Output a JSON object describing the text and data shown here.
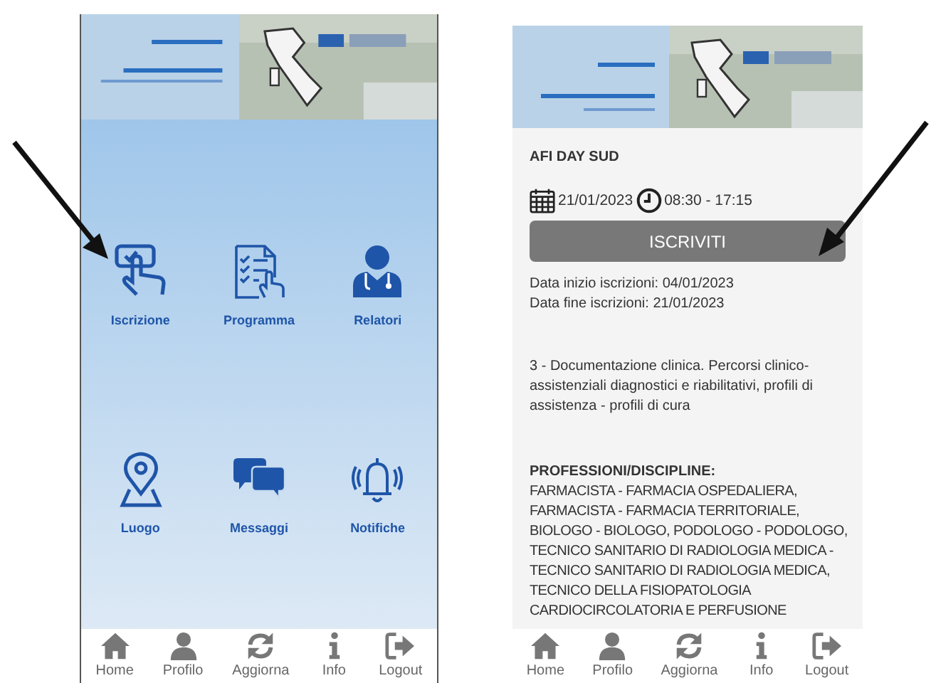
{
  "menu_screen": {
    "tiles": [
      {
        "label": "Iscrizione"
      },
      {
        "label": "Programma"
      },
      {
        "label": "Relatori"
      },
      {
        "label": "Luogo"
      },
      {
        "label": "Messaggi"
      },
      {
        "label": "Notifiche"
      }
    ],
    "nav": [
      {
        "label": "Home"
      },
      {
        "label": "Profilo"
      },
      {
        "label": "Aggiorna"
      },
      {
        "label": "Info"
      },
      {
        "label": "Logout"
      }
    ]
  },
  "detail_screen": {
    "title": "AFI DAY SUD",
    "date": "21/01/2023",
    "time": "08:30 - 17:15",
    "button": "ISCRIVITI",
    "registration": [
      "Data inizio iscrizioni: 04/01/2023",
      "Data fine iscrizioni: 21/01/2023"
    ],
    "description": "3 - Documentazione clinica. Percorsi clinico-assistenziali diagnostici e riabilitativi, profili di assistenza - profili di cura",
    "professions_heading": "PROFESSIONI/DISCIPLINE:",
    "professions": [
      "FARMACISTA - FARMACIA OSPEDALIERA,",
      "FARMACISTA - FARMACIA TERRITORIALE,",
      "BIOLOGO - BIOLOGO, PODOLOGO - PODOLOGO,",
      "TECNICO SANITARIO DI RADIOLOGIA MEDICA -",
      "TECNICO SANITARIO DI RADIOLOGIA MEDICA,",
      "TECNICO DELLA FISIOPATOLOGIA",
      "CARDIOCIRCOLATORIA E PERFUSIONE"
    ],
    "nav": [
      {
        "label": "Home"
      },
      {
        "label": "Profilo"
      },
      {
        "label": "Aggiorna"
      },
      {
        "label": "Info"
      },
      {
        "label": "Logout"
      }
    ]
  }
}
